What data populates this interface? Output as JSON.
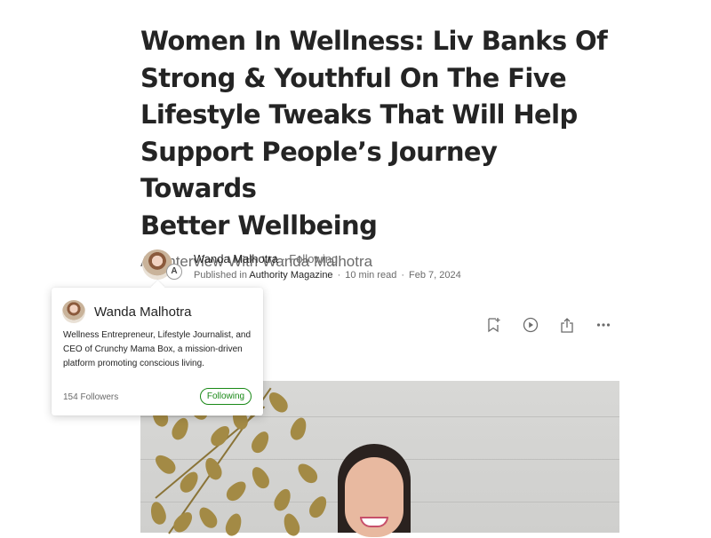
{
  "article": {
    "title": "Women In Wellness: Liv Banks Of\nStrong & Youthful On The Five\nLifestyle Tweaks That Will Help\nSupport People’s Journey Towards\nBetter Wellbeing",
    "subtitle": "An Interview With Wanda Malhotra"
  },
  "byline": {
    "author": "Wanda Malhotra",
    "separator": "·",
    "follow_label": "Following",
    "published_in_prefix": "Published in",
    "publication": "Authority Magazine",
    "read_time": "10 min read",
    "date": "Feb 7, 2024",
    "publication_badge": "A"
  },
  "actions": {
    "icons": [
      "bookmark-add-icon",
      "play-icon",
      "share-icon",
      "more-icon"
    ]
  },
  "hovercard": {
    "name": "Wanda Malhotra",
    "bio": "Wellness Entrepreneur, Lifestyle Journalist, and CEO of Crunchy Mama Box, a mission-driven platform promoting conscious living.",
    "followers": "154 Followers",
    "follow_label": "Following",
    "accent_color": "#1a8917"
  }
}
